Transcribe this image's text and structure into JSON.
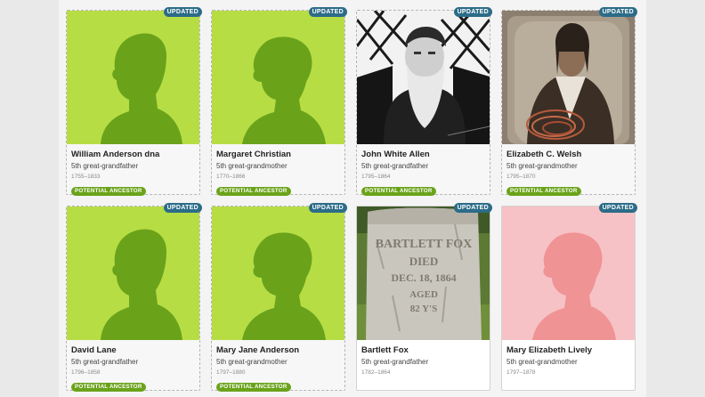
{
  "colors": {
    "placeholder_green": "#b7dd45",
    "silhouette_green": "#6aa31a",
    "placeholder_pink": "#f7c2c5",
    "silhouette_pink": "#ef9395",
    "updated_badge": "#2c6c88",
    "potential_badge": "#6aa31a"
  },
  "cards": [
    {
      "name": "William Anderson dna",
      "relationship": "5th great-grandfather",
      "dates": "1755–1833",
      "badge": "UPDATED",
      "tag": "POTENTIAL ANCESTOR",
      "photo": "male-silhouette-icon"
    },
    {
      "name": "Margaret Christian",
      "relationship": "5th great-grandmother",
      "dates": "1770–1866",
      "badge": "UPDATED",
      "tag": "POTENTIAL ANCESTOR",
      "photo": "female-silhouette-icon"
    },
    {
      "name": "John White Allen",
      "relationship": "5th great-grandfather",
      "dates": "1795–1864",
      "badge": "UPDATED",
      "tag": "POTENTIAL ANCESTOR",
      "photo": "bearded-man-photo"
    },
    {
      "name": "Elizabeth C. Welsh",
      "relationship": "5th great-grandmother",
      "dates": "1795–1870",
      "badge": "UPDATED",
      "tag": "POTENTIAL ANCESTOR",
      "photo": "tintype-woman-photo"
    },
    {
      "name": "David Lane",
      "relationship": "5th great-grandfather",
      "dates": "1796–1858",
      "badge": "UPDATED",
      "tag": "POTENTIAL ANCESTOR",
      "photo": "male-silhouette-icon"
    },
    {
      "name": "Mary Jane Anderson",
      "relationship": "5th great-grandmother",
      "dates": "1797–1880",
      "badge": "UPDATED",
      "tag": "POTENTIAL ANCESTOR",
      "photo": "female-silhouette-icon"
    },
    {
      "name": "Bartlett Fox",
      "relationship": "5th great-grandfather",
      "dates": "1782–1864",
      "badge": "UPDATED",
      "tag": "",
      "photo": "gravestone-photo"
    },
    {
      "name": "Mary Elizabeth Lively",
      "relationship": "5th great-grandmother",
      "dates": "1797–1878",
      "badge": "UPDATED",
      "tag": "",
      "photo": "female-silhouette-pink-icon"
    }
  ],
  "gravestone_inscription": [
    "BARTLETT FOX",
    "DIED",
    "DEC. 18, 1864",
    "AGED",
    "82 Y'S"
  ]
}
